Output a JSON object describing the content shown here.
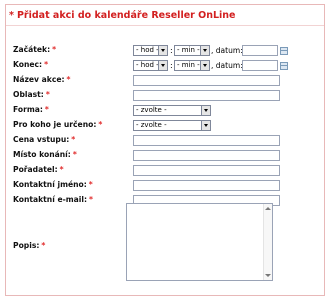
{
  "title": "Přidat akci do kalendáře Reseller OnLine",
  "title_icon": "*",
  "required_mark": "*",
  "fields": {
    "zacatek": {
      "label": "Začátek:",
      "hod": "- hod -",
      "min": "- min -",
      "datum_label": ", datum:"
    },
    "konec": {
      "label": "Konec:",
      "hod": "- hod -",
      "min": "- min -",
      "datum_label": ", datum:"
    },
    "nazev": {
      "label": "Název akce:"
    },
    "oblast": {
      "label": "Oblast:"
    },
    "forma": {
      "label": "Forma:",
      "select": "- zvolte -"
    },
    "prokoho": {
      "label": "Pro koho je určeno:",
      "select": "- zvolte -"
    },
    "cena": {
      "label": "Cena vstupu:"
    },
    "misto": {
      "label": "Místo konání:"
    },
    "poradatel": {
      "label": "Pořadatel:"
    },
    "kontaktni_jmeno": {
      "label": "Kontaktní jméno:"
    },
    "kontaktni_email": {
      "label": "Kontaktní e-mail:"
    },
    "popis": {
      "label": "Popis:"
    }
  },
  "colors": {
    "accent": "#d21f1f",
    "border": "#9aa3b6"
  },
  "icons": {
    "calendar": "calendar-icon",
    "dropdown": "chevron-down-icon",
    "scroll_up": "arrow-up-icon",
    "scroll_down": "arrow-down-icon"
  }
}
